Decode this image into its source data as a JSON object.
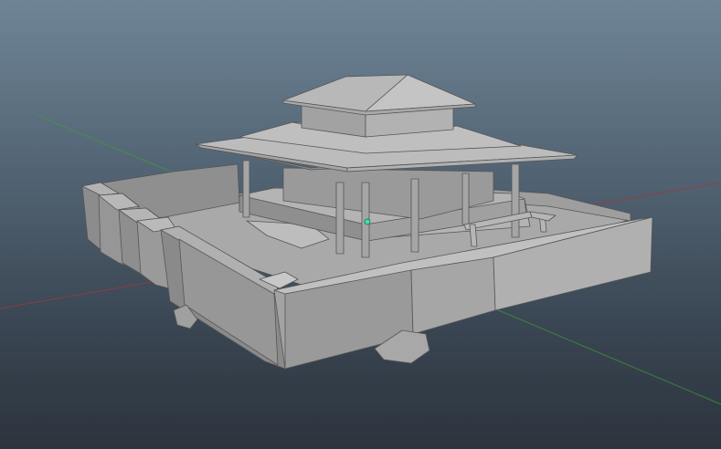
{
  "viewport": {
    "background_top": "#6f8596",
    "background_bottom": "#2c343d",
    "axis_x_color": "#9a3b3b",
    "axis_z_color": "#3f9a3a",
    "pivot_color": "#3fe0b0"
  },
  "scene": {
    "model": "pagoda-compound",
    "shading": "flat-gray",
    "base_color": "#9b9b9b",
    "edge_color": "#4d4d4d"
  }
}
